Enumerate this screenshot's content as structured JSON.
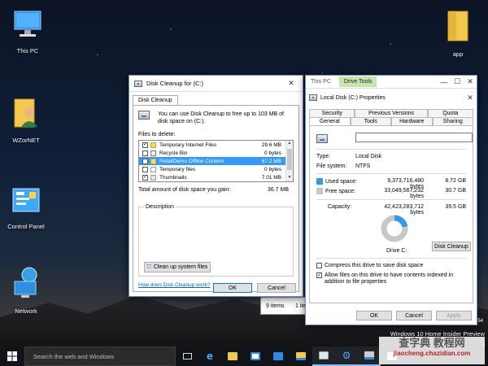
{
  "desktop": {
    "icons": [
      {
        "label": "This PC"
      },
      {
        "label": "WZorNET"
      },
      {
        "label": "Control Panel"
      },
      {
        "label": "Network"
      },
      {
        "label": "app"
      }
    ],
    "watermark_edition": "Windows 10 Home Insider Preview",
    "watermark_line2": "54",
    "watermark_line3": "5"
  },
  "disk_cleanup": {
    "title": "Disk Cleanup for  (C:)",
    "tab": "Disk Cleanup",
    "intro": "You can use Disk Cleanup to free up to 103 MB of disk space on  (C:).",
    "files_to_delete_label": "Files to delete:",
    "files": [
      {
        "name": "Temporary Internet Files",
        "size": "29.6 MB",
        "checked": true
      },
      {
        "name": "Recycle Bin",
        "size": "0 bytes",
        "checked": false
      },
      {
        "name": "RetailDemo Offline Content",
        "size": "67.2 MB",
        "checked": false,
        "selected": true
      },
      {
        "name": "Temporary files",
        "size": "0 bytes",
        "checked": false
      },
      {
        "name": "Thumbnails",
        "size": "7.01 MB",
        "checked": true
      }
    ],
    "total_label": "Total amount of disk space you gain:",
    "total_value": "36.7 MB",
    "description_label": "Description",
    "clean_system_button": "Clean up system files",
    "how_link": "How does Disk Cleanup work?",
    "ok": "OK",
    "cancel": "Cancel"
  },
  "explorer_behind": {
    "status_items": "9 items",
    "status_items2": "1 iter"
  },
  "properties": {
    "window_title": "This PC",
    "ribbon_tab": "Drive Tools",
    "sheet_title": "Local Disk (C:) Properties",
    "tabs_row1": [
      "Security",
      "Previous Versions",
      "Quota"
    ],
    "tabs_row2": [
      "General",
      "Tools",
      "Hardware",
      "Sharing"
    ],
    "name_value": "",
    "type_label": "Type:",
    "type_value": "Local Disk",
    "fs_label": "File system:",
    "fs_value": "NTFS",
    "used_label": "Used space:",
    "used_bytes": "9,373,716,480 bytes",
    "used_gb": "8.72 GB",
    "free_label": "Free space:",
    "free_bytes": "33,049,567,232 bytes",
    "free_gb": "30.7 GB",
    "capacity_label": "Capacity:",
    "capacity_bytes": "42,423,283,712 bytes",
    "capacity_gb": "39.5 GB",
    "drive_label": "Drive C:",
    "disk_cleanup_button": "Disk Cleanup",
    "compress_label": "Compress this drive to save disk space",
    "compress_checked": false,
    "index_label": "Allow files on this drive to have contents indexed in addition to file properties",
    "index_checked": true,
    "ok": "OK",
    "cancel": "Cancel",
    "apply": "Apply",
    "used_fraction": 0.221,
    "colors": {
      "used": "#2f9de0",
      "free": "#c7c7c7"
    }
  },
  "taskbar": {
    "search_placeholder": "Search the web and Windows"
  },
  "overlay_watermark": {
    "line1": "查字典 教程网",
    "line2": "jiaocheng.chazidian.com"
  }
}
